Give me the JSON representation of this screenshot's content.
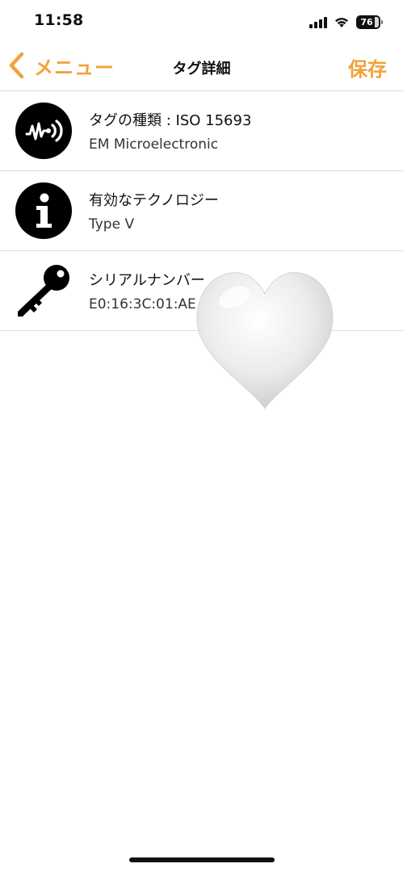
{
  "status_bar": {
    "time": "11:58",
    "battery": "76",
    "icons": [
      "signal-icon",
      "wifi-icon",
      "battery-icon"
    ]
  },
  "nav": {
    "back_label": "メニュー",
    "title": "タグ詳細",
    "save_label": "保存",
    "accent_color": "#F2A23A"
  },
  "rows": [
    {
      "icon": "nfc-tag-icon",
      "title": "タグの種類 : ISO 15693",
      "subtitle": "EM Microelectronic"
    },
    {
      "icon": "info-icon",
      "title": "有効なテクノロジー",
      "subtitle": "Type V"
    },
    {
      "icon": "key-icon",
      "title": "シリアルナンバー",
      "subtitle": "E0:16:3C:01:AE"
    }
  ]
}
